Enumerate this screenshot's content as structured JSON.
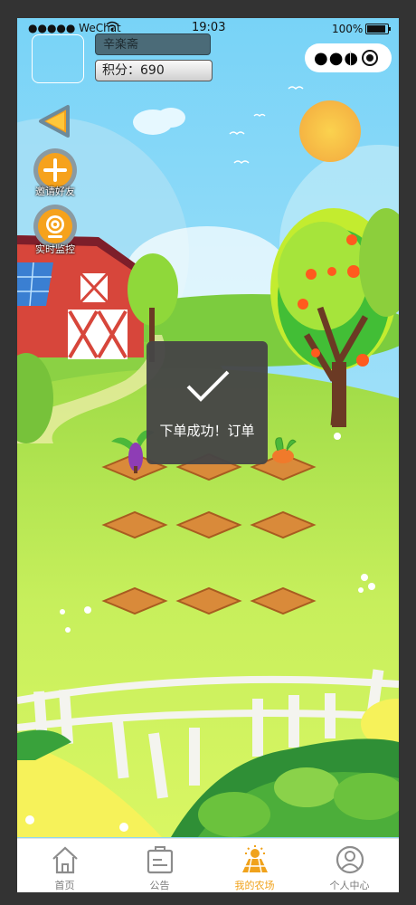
{
  "status_bar": {
    "signal": "●●●●● WeChat",
    "time": "19:03",
    "battery": "100%"
  },
  "header": {
    "username": "辛楽斋",
    "points_label": "积分：",
    "points_value": "690"
  },
  "capsule": {
    "more_icon": "more-dots-icon",
    "close_icon": "target-circle-icon"
  },
  "side_buttons": [
    {
      "icon": "back-arrow-icon",
      "label": ""
    },
    {
      "icon": "plus-circle-icon",
      "label": "邀请好友"
    },
    {
      "icon": "camera-icon",
      "label": "实时监控"
    }
  ],
  "farm": {
    "plots": 9,
    "planted": [
      "eggplant",
      "empty",
      "carrot",
      "empty",
      "empty",
      "empty",
      "empty",
      "empty",
      "empty"
    ]
  },
  "toast": {
    "icon": "checkmark-icon",
    "message": "下单成功！订单"
  },
  "tabbar": {
    "items": [
      {
        "icon": "home-icon",
        "label": "首页",
        "active": false
      },
      {
        "icon": "notice-icon",
        "label": "公告",
        "active": false
      },
      {
        "icon": "farm-icon",
        "label": "我的农场",
        "active": true
      },
      {
        "icon": "user-icon",
        "label": "个人中心",
        "active": false
      }
    ]
  },
  "colors": {
    "sky": "#8fd7f2",
    "grass": "#b9e85a",
    "soil": "#d98a3a",
    "accent": "#f0a21b",
    "toast_bg": "#464646"
  }
}
